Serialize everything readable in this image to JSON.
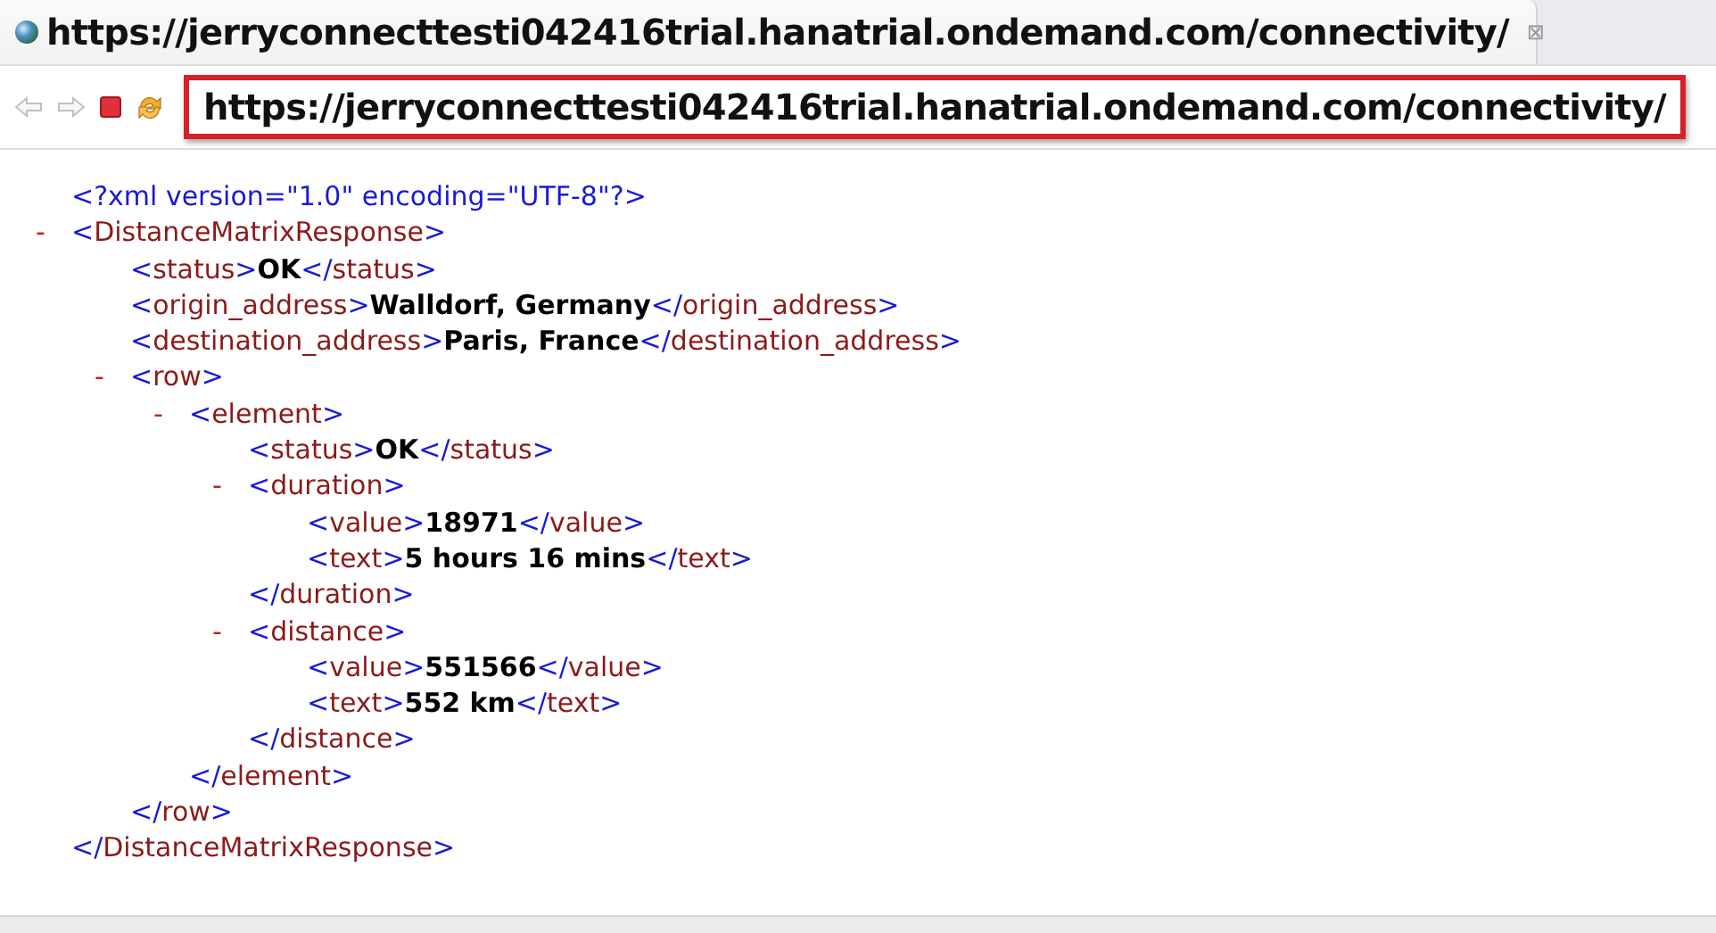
{
  "tab": {
    "title": "https://jerryconnecttesti042416trial.hanatrial.ondemand.com/connectivity/",
    "close": "⊠"
  },
  "toolbar": {
    "back_disabled": true,
    "forward_disabled": true,
    "url": "https://jerryconnecttesti042416trial.hanatrial.ondemand.com/connectivity/",
    "url_highlighted": true
  },
  "document": {
    "declaration": "<?xml version=\"1.0\" encoding=\"UTF-8\"?>",
    "root": {
      "toggle": "-",
      "open": "<DistanceMatrixResponse>",
      "close": "</DistanceMatrixResponse>",
      "children": [
        {
          "open": "<status>",
          "value": "OK",
          "close": "</status>"
        },
        {
          "open": "<origin_address>",
          "value": "Walldorf, Germany",
          "close": "</origin_address>"
        },
        {
          "open": "<destination_address>",
          "value": "Paris, France",
          "close": "</destination_address>"
        },
        {
          "toggle": "-",
          "open": "<row>",
          "close": "</row>",
          "children": [
            {
              "toggle": "-",
              "open": "<element>",
              "close": "</element>",
              "children": [
                {
                  "open": "<status>",
                  "value": "OK",
                  "close": "</status>"
                },
                {
                  "toggle": "-",
                  "open": "<duration>",
                  "close": "</duration>",
                  "children": [
                    {
                      "open": "<value>",
                      "value": "18971",
                      "close": "</value>"
                    },
                    {
                      "open": "<text>",
                      "value": "5 hours 16 mins",
                      "close": "</text>"
                    }
                  ]
                },
                {
                  "toggle": "-",
                  "open": "<distance>",
                  "close": "</distance>",
                  "children": [
                    {
                      "open": "<value>",
                      "value": "551566",
                      "close": "</value>"
                    },
                    {
                      "open": "<text>",
                      "value": "552 km",
                      "close": "</text>"
                    }
                  ]
                }
              ]
            }
          ]
        }
      ]
    }
  }
}
